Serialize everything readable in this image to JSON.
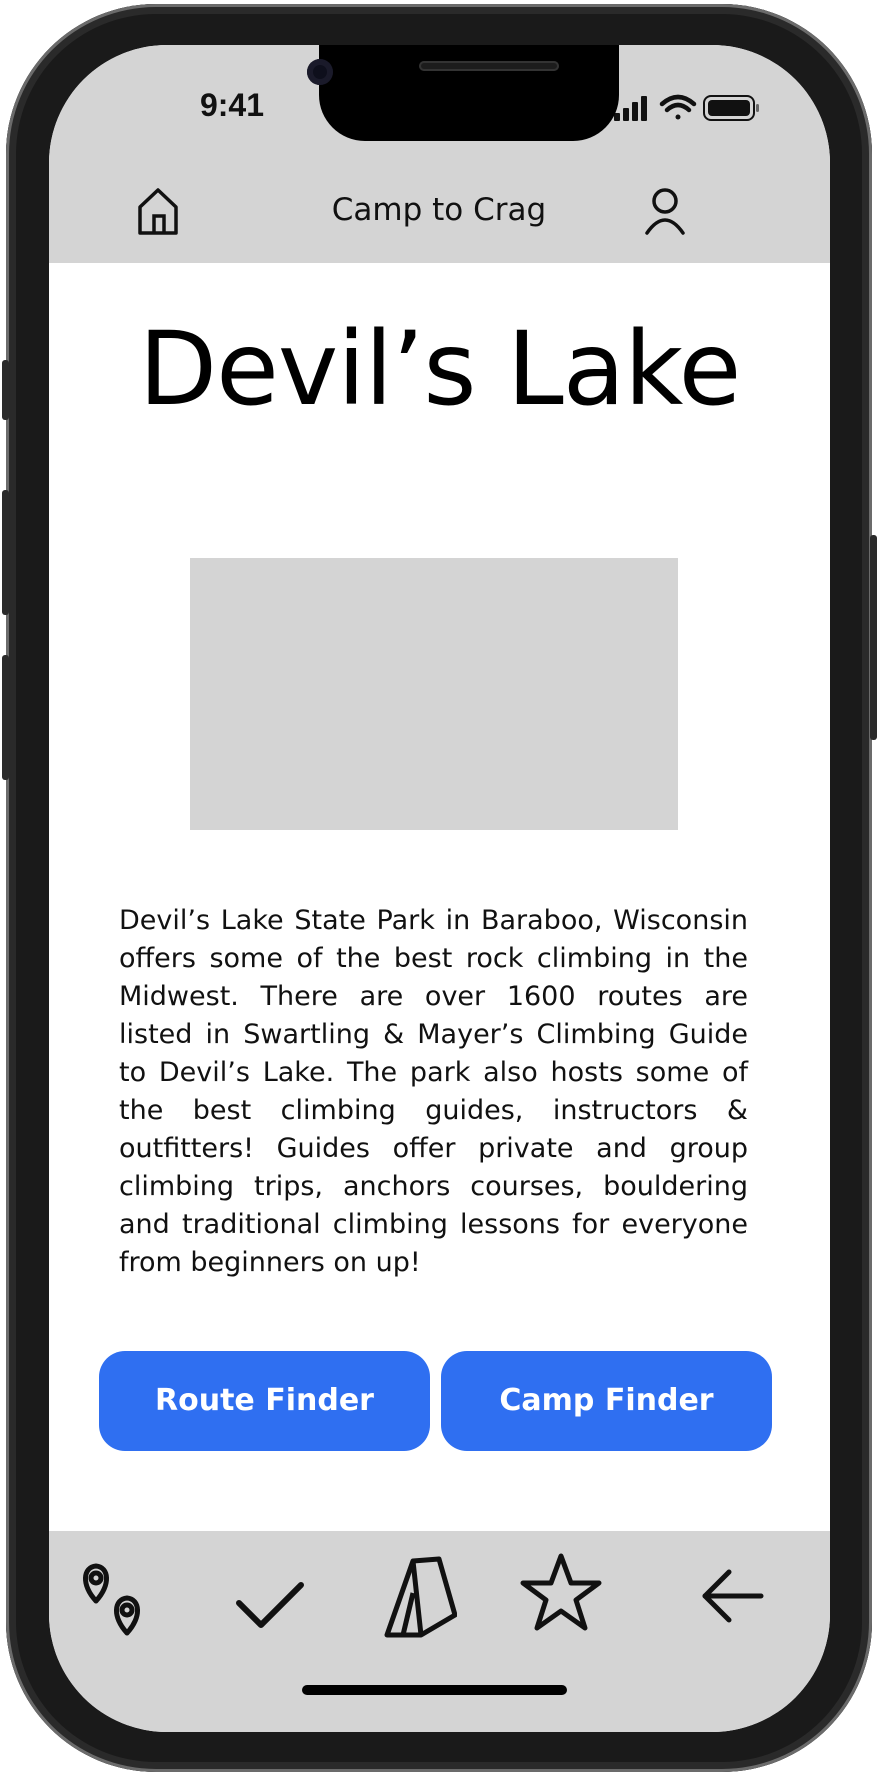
{
  "status_bar": {
    "time": "9:41"
  },
  "header": {
    "title": "Camp to Crag",
    "home_icon": "home-icon",
    "profile_icon": "user-icon"
  },
  "main": {
    "title": "Devil’s Lake",
    "description": "Devil’s Lake State Park in Baraboo, Wisconsin offers some of the best rock climbing in the Midwest. There are over 1600 routes are listed in Swartling & Mayer’s Climbing Guide to Devil’s Lake. The park also hosts some of the best climbing guides, instructors & outfitters! Guides offer private and group climbing trips, anchors courses, bouldering and traditional climbing lessons for everyone from beginners on up!",
    "buttons": {
      "route_finder": "Route Finder",
      "camp_finder": "Camp Finder"
    }
  },
  "tabbar": {
    "items": [
      {
        "icon": "map-pins-icon"
      },
      {
        "icon": "checkmark-icon"
      },
      {
        "icon": "tent-icon"
      },
      {
        "icon": "star-icon"
      },
      {
        "icon": "back-arrow-icon"
      }
    ]
  },
  "colors": {
    "accent": "#2f6ff1",
    "bar_background": "#d4d4d4",
    "placeholder": "#d4d4d4"
  }
}
